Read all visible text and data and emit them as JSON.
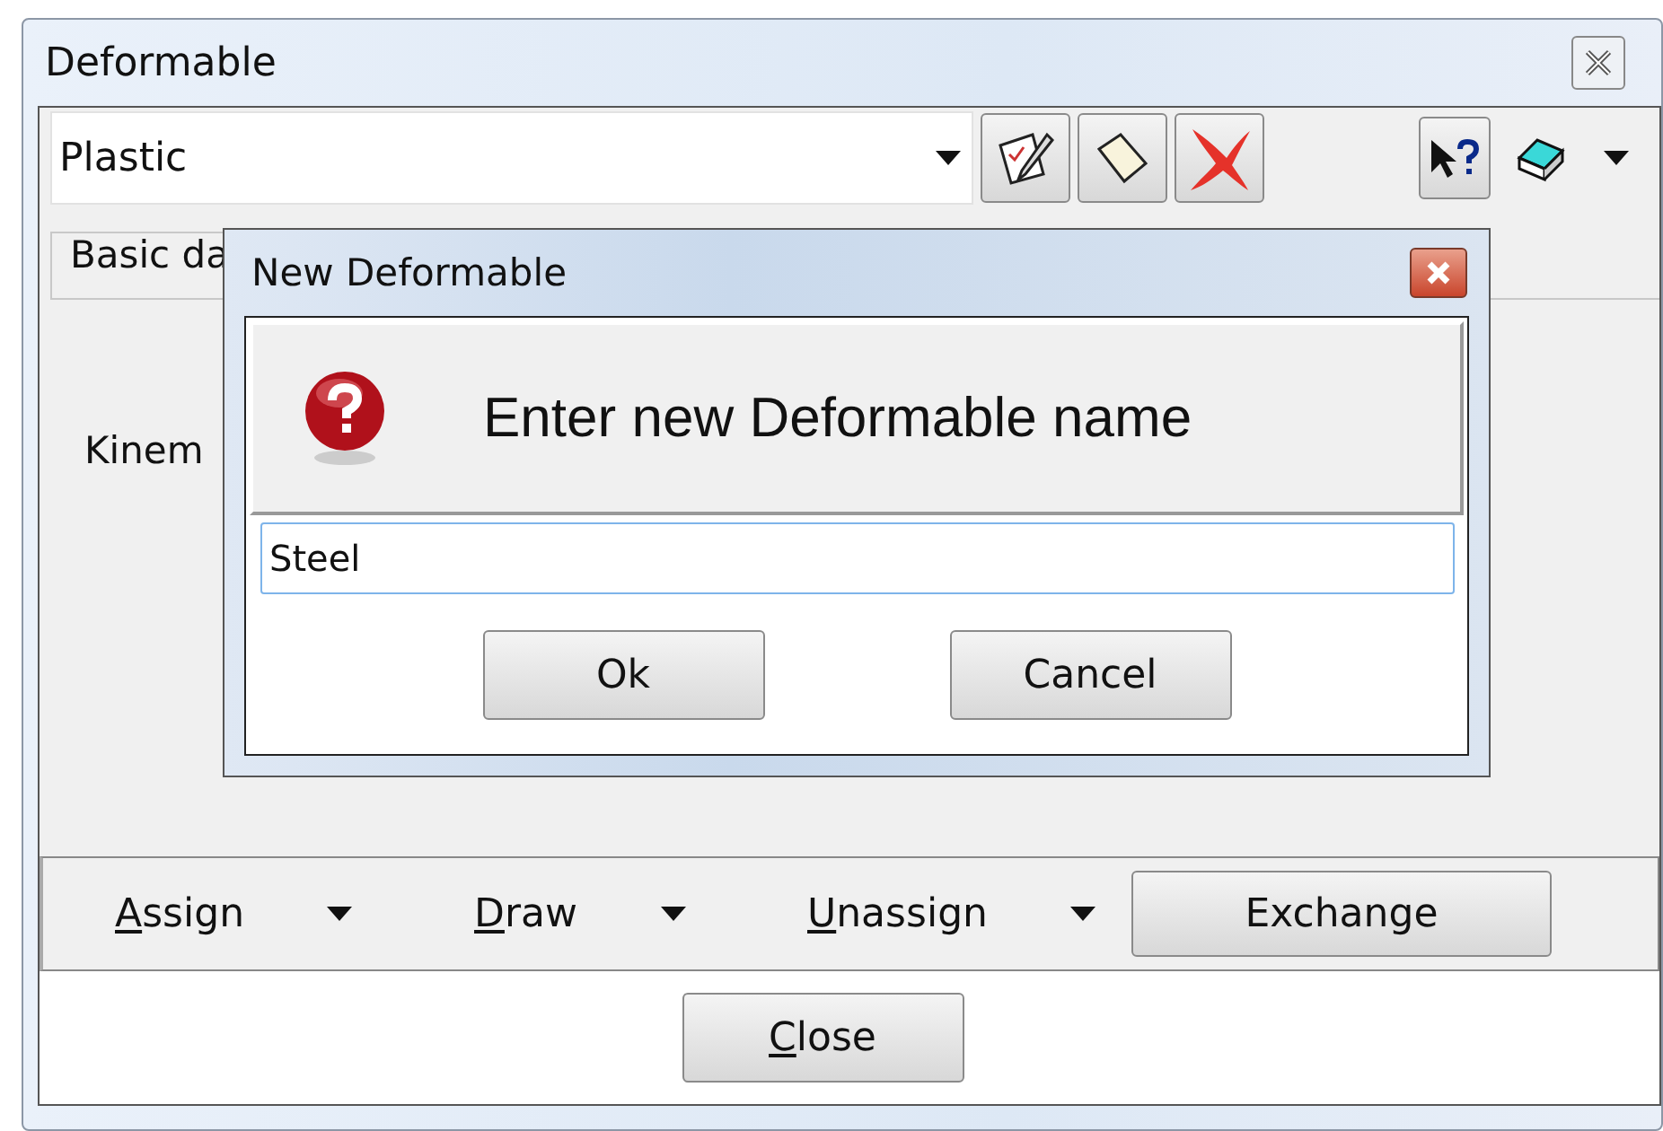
{
  "window": {
    "title": "Deformable"
  },
  "toolbar": {
    "selector": {
      "value": "Plastic"
    }
  },
  "tabs": [
    {
      "label": "Basic da",
      "selected": true
    }
  ],
  "body": {
    "label": "Kinem"
  },
  "actions": [
    {
      "kind": "menu",
      "label": "Assign",
      "mnemonic": true
    },
    {
      "kind": "menu",
      "label": "Draw",
      "mnemonic": true
    },
    {
      "kind": "menu",
      "label": "Unassign",
      "mnemonic": true
    },
    {
      "kind": "button",
      "label": "Exchange",
      "mnemonic": false
    }
  ],
  "footer": {
    "button": {
      "label": "Close",
      "mnemonic": true
    }
  },
  "dialog": {
    "title": "New Deformable",
    "message": "Enter new Deformable name",
    "input": {
      "value": "Steel",
      "focused": true
    },
    "buttons": [
      "Ok",
      "Cancel"
    ]
  }
}
